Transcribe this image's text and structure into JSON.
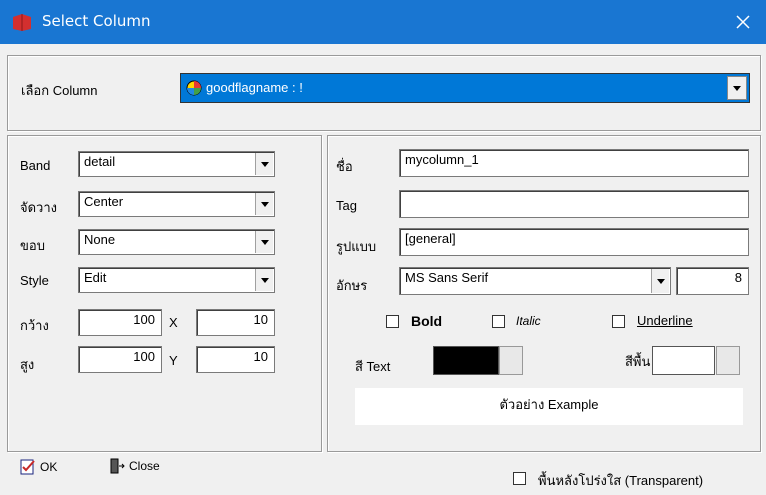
{
  "window": {
    "title": "Select Column",
    "close_icon": "close-icon",
    "accent": "#1976d2"
  },
  "select_column": {
    "label": "เลือก Column",
    "value": "goodflagname : !"
  },
  "left": {
    "band_label": "Band",
    "band_value": "detail",
    "align_label": "จัดวาง",
    "align_value": "Center",
    "border_label": "ขอบ",
    "border_value": "None",
    "style_label": "Style",
    "style_value": "Edit",
    "width_label": "กว้าง",
    "width_value": "100",
    "x_label": "X",
    "x_value": "10",
    "height_label": "สูง",
    "height_value": "100",
    "y_label": "Y",
    "y_value": "10"
  },
  "right": {
    "name_label": "ชื่อ",
    "name_value": "mycolumn_1",
    "tag_label": "Tag",
    "tag_value": "",
    "format_label": "รูปแบบ",
    "format_value": "[general]",
    "font_label": "อักษร",
    "font_value": "MS Sans Serif",
    "font_size": "8",
    "bold_label": "Bold",
    "italic_label": "Italic",
    "underline_label": "Underline",
    "text_color_label": "สี Text",
    "text_color": "#000000",
    "bg_color_label": "สีพื้น",
    "bg_color": "#ffffff",
    "example_text": "ตัวอย่าง Example"
  },
  "footer": {
    "ok_label": "OK",
    "close_label": "Close",
    "transparent_label": "พื้นหลังโปร่งใส (Transparent)"
  }
}
